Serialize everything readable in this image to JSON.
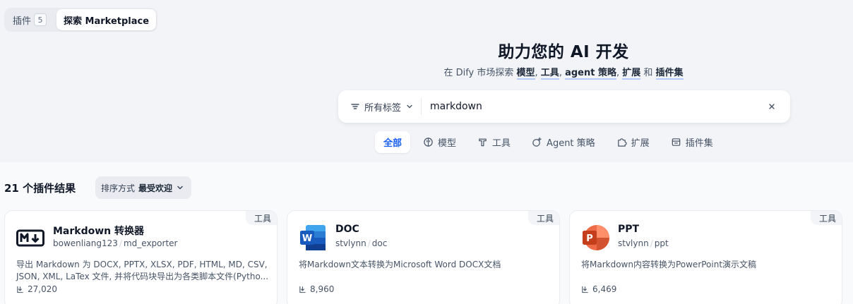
{
  "switcher": {
    "tabs": [
      {
        "label": "插件",
        "count": "5"
      },
      {
        "label": "探索 Marketplace"
      }
    ]
  },
  "hero": {
    "title": "助力您的 AI 开发",
    "subtitle": {
      "prefix": "在 Dify 市场探索 ",
      "t1": "模型",
      "s1": ", ",
      "t2": "工具",
      "s2": ", ",
      "t3": "agent 策略",
      "s3": ", ",
      "t4": "扩展",
      "s4": " 和 ",
      "t5": "插件集"
    }
  },
  "search": {
    "tag_filter_label": "所有标签",
    "value": "markdown"
  },
  "categories": [
    {
      "label": "全部",
      "icon": "none"
    },
    {
      "label": "模型",
      "icon": "brain-icon"
    },
    {
      "label": "工具",
      "icon": "hammer-icon"
    },
    {
      "label": "Agent 策略",
      "icon": "agent-icon"
    },
    {
      "label": "扩展",
      "icon": "puzzle-icon"
    },
    {
      "label": "插件集",
      "icon": "bundle-icon"
    }
  ],
  "results": {
    "title": "21 个插件结果",
    "sort_prefix": "排序方式",
    "sort_value": "最受欢迎"
  },
  "cards": [
    {
      "badge": "工具",
      "name": "Markdown 转换器",
      "org": "bowenliang123",
      "plugin": "md_exporter",
      "description": "导出 Markdown 为 DOCX, PPTX, XLSX, PDF, HTML, MD, CSV, JSON, XML, LaTex 文件, 并将代码块导出为各类脚本文件(Pytho...",
      "downloads": "27,020",
      "icon": "markdown-icon"
    },
    {
      "badge": "工具",
      "name": "DOC",
      "org": "stvlynn",
      "plugin": "doc",
      "description": "将Markdown文本转换为Microsoft Word DOCX文档",
      "downloads": "8,960",
      "icon": "word-icon"
    },
    {
      "badge": "工具",
      "name": "PPT",
      "org": "stvlynn",
      "plugin": "ppt",
      "description": "将Markdown内容转换为PowerPoint演示文稿",
      "downloads": "6,469",
      "icon": "powerpoint-icon"
    }
  ],
  "colors": {
    "accent": "#155eef",
    "hero_bg": "#f2f4f7",
    "word_blue": "#185abd",
    "ppt_red": "#c43e1c"
  }
}
